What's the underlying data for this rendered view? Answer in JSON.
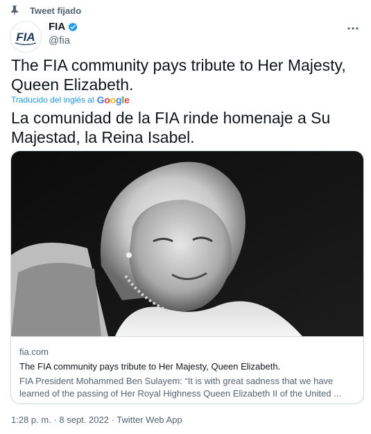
{
  "pinned": {
    "label": "Tweet fijado",
    "icon": "pin-icon"
  },
  "author": {
    "name": "FIA",
    "handle": "@fia",
    "avatar_text": "FIA",
    "verified_icon": "verified-badge-icon"
  },
  "menu": {
    "icon": "more-options-icon"
  },
  "tweet": {
    "text": "The FIA community pays tribute to Her Majesty, Queen Elizabeth.",
    "translation_prefix": "Traducido del inglés al",
    "translation_provider": "Google",
    "translated_text": "La comunidad de la FIA rinde homenaje a Su Majestad, la Reina Isabel."
  },
  "card": {
    "image_alt": "Black-and-white portrait of Queen Elizabeth",
    "domain": "fia.com",
    "title": "The FIA community pays tribute to Her Majesty, Queen Elizabeth.",
    "description": "FIA President Mohammed Ben Sulayem: “It is with great sadness that we have learned of the passing of Her Royal Highness Queen Elizabeth II of the United ..."
  },
  "meta": {
    "time": "1:28 p. m.",
    "separator": " · ",
    "date": "8 sept. 2022",
    "source": "Twitter Web App"
  },
  "colors": {
    "accent": "#1d9bf0",
    "text": "#0f1419",
    "secondary": "#536471",
    "border": "#cfd9de"
  }
}
